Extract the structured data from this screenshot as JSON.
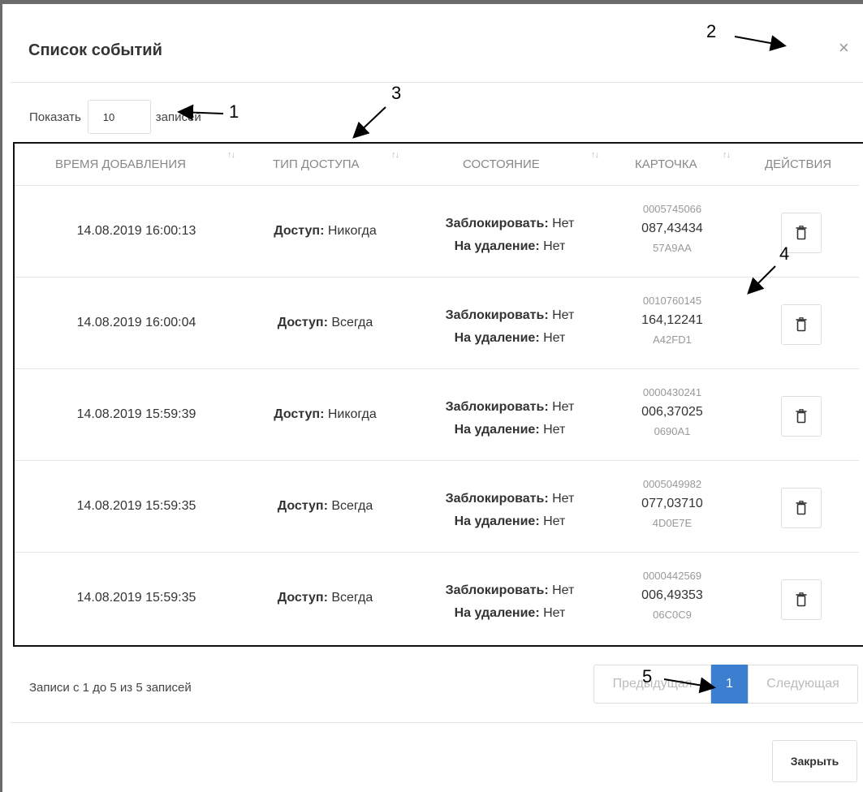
{
  "modal": {
    "title": "Список событий",
    "close_symbol": "×"
  },
  "length": {
    "label_before": "Показать",
    "value": "10",
    "label_after": "записей"
  },
  "table": {
    "columns": [
      {
        "label": "ВРЕМЯ ДОБАВЛЕНИЯ",
        "sortable": true
      },
      {
        "label": "ТИП ДОСТУПА",
        "sortable": true
      },
      {
        "label": "СОСТОЯНИЕ",
        "sortable": true
      },
      {
        "label": "КАРТОЧКА",
        "sortable": true
      },
      {
        "label": "ДЕЙСТВИЯ",
        "sortable": false
      }
    ],
    "sort_glyph": "↑↓",
    "access_label": "Доступ:",
    "block_label": "Заблокировать:",
    "delete_label": "На удаление:",
    "rows": [
      {
        "time": "14.08.2019 16:00:13",
        "access": "Никогда",
        "block": "Нет",
        "deletion": "Нет",
        "card_num": "0005745066",
        "card_mid": "087,43434",
        "card_hex": "57A9AA"
      },
      {
        "time": "14.08.2019 16:00:04",
        "access": "Всегда",
        "block": "Нет",
        "deletion": "Нет",
        "card_num": "0010760145",
        "card_mid": "164,12241",
        "card_hex": "A42FD1"
      },
      {
        "time": "14.08.2019 15:59:39",
        "access": "Никогда",
        "block": "Нет",
        "deletion": "Нет",
        "card_num": "0000430241",
        "card_mid": "006,37025",
        "card_hex": "0690A1"
      },
      {
        "time": "14.08.2019 15:59:35",
        "access": "Всегда",
        "block": "Нет",
        "deletion": "Нет",
        "card_num": "0005049982",
        "card_mid": "077,03710",
        "card_hex": "4D0E7E"
      },
      {
        "time": "14.08.2019 15:59:35",
        "access": "Всегда",
        "block": "Нет",
        "deletion": "Нет",
        "card_num": "0000442569",
        "card_mid": "006,49353",
        "card_hex": "06C0C9"
      }
    ],
    "delete_icon": "trash-icon"
  },
  "info": "Записи с 1 до 5 из 5 записей",
  "pagination": {
    "prev": "Предыдущая",
    "current": "1",
    "next": "Следующая",
    "active_color": "#3c7fd0"
  },
  "footer": {
    "close_label": "Закрыть"
  },
  "callouts": [
    "1",
    "2",
    "3",
    "4",
    "5"
  ]
}
